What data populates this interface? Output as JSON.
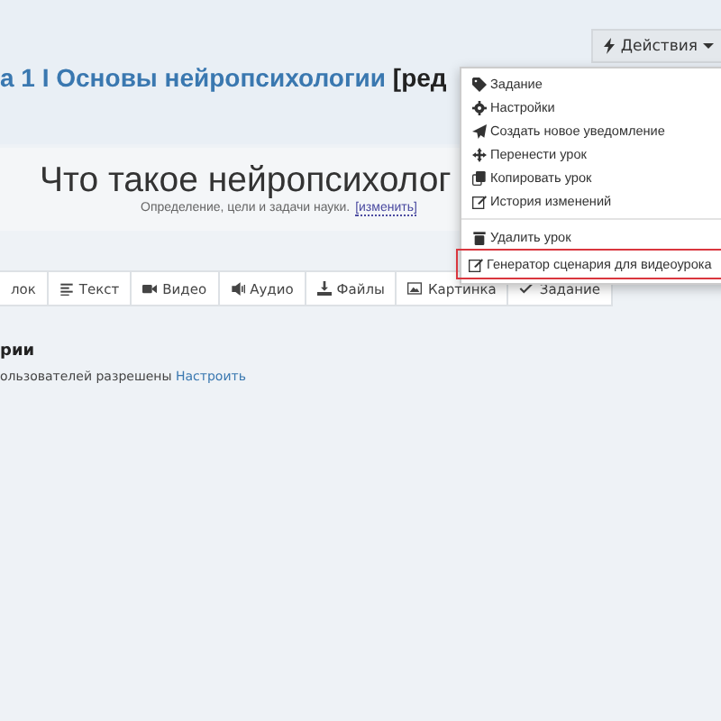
{
  "header": {
    "title_link": "а 1 I Основы нейропсихологии",
    "title_rest": "[ред",
    "actions_button": "Действия"
  },
  "lesson": {
    "heading": "Что такое нейропсихолог",
    "subtitle": "Определение, цели и задачи науки.",
    "edit_link": "[изменить]"
  },
  "toolbar": [
    "лок",
    "Текст",
    "Видео",
    "Аудио",
    "Файлы",
    "Картинка",
    "Задание"
  ],
  "section": {
    "title": "рии",
    "text": "ользователей разрешены",
    "link": "Настроить"
  },
  "menu_sections": [
    {
      "items": [
        {
          "label": "Задание",
          "selected": false
        },
        {
          "label": "Настройки",
          "selected": false
        },
        {
          "label": "Создать новое уведомление",
          "selected": false
        },
        {
          "label": "Перенести урок",
          "selected": false
        },
        {
          "label": "Копировать урок",
          "selected": false
        },
        {
          "label": "История изменений",
          "selected": false
        }
      ]
    },
    {
      "items": [
        {
          "label": "Удалить урок",
          "selected": false
        },
        {
          "label": "Генератор сценария для видеоурока",
          "selected": true
        }
      ]
    }
  ]
}
